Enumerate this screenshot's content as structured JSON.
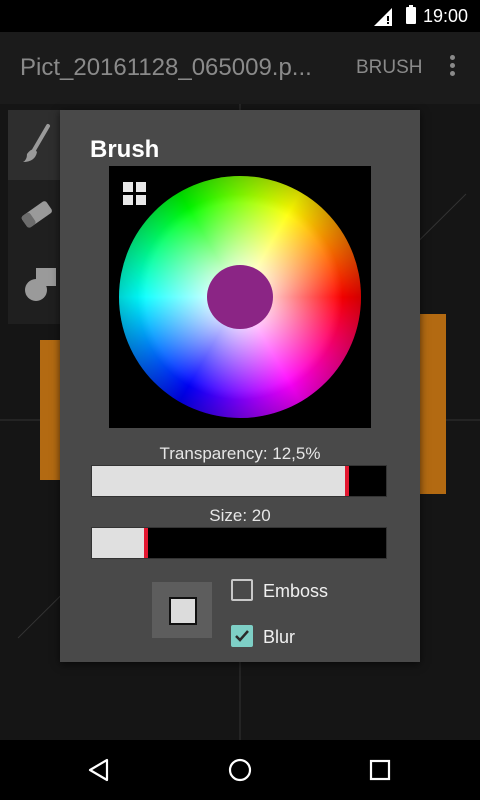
{
  "status_bar": {
    "time": "19:00"
  },
  "app_bar": {
    "title": "Pict_20161128_065009.p...",
    "mode": "BRUSH"
  },
  "dialog": {
    "title": "Brush",
    "selected_color": "#8b2585",
    "transparency_label": "Transparency: 12,5%",
    "transparency": 0.875,
    "size_label": "Size: 20",
    "size": 0.19,
    "options": [
      {
        "label": "Emboss",
        "checked": false
      },
      {
        "label": "Blur",
        "checked": true
      }
    ]
  },
  "colors": {
    "accent": "#7ecfc6",
    "slider_knob": "#e2162f"
  }
}
